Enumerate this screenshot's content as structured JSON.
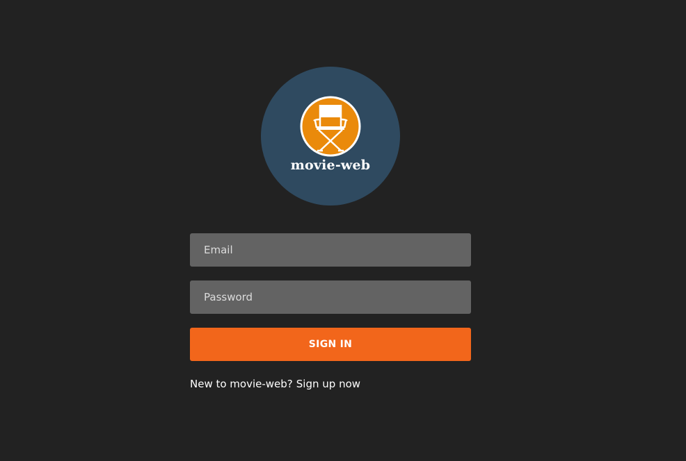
{
  "logo": {
    "wordmark": "movie-web",
    "icon": "director-chair-icon",
    "circle_color": "#2f4a60",
    "badge_color": "#ea8a0b"
  },
  "form": {
    "email_placeholder": "Email",
    "password_placeholder": "Password",
    "signin_label": "SIGN IN",
    "signin_color": "#f2661b"
  },
  "signup": {
    "prompt": "New to movie-web?",
    "link_label": "Sign up now"
  }
}
